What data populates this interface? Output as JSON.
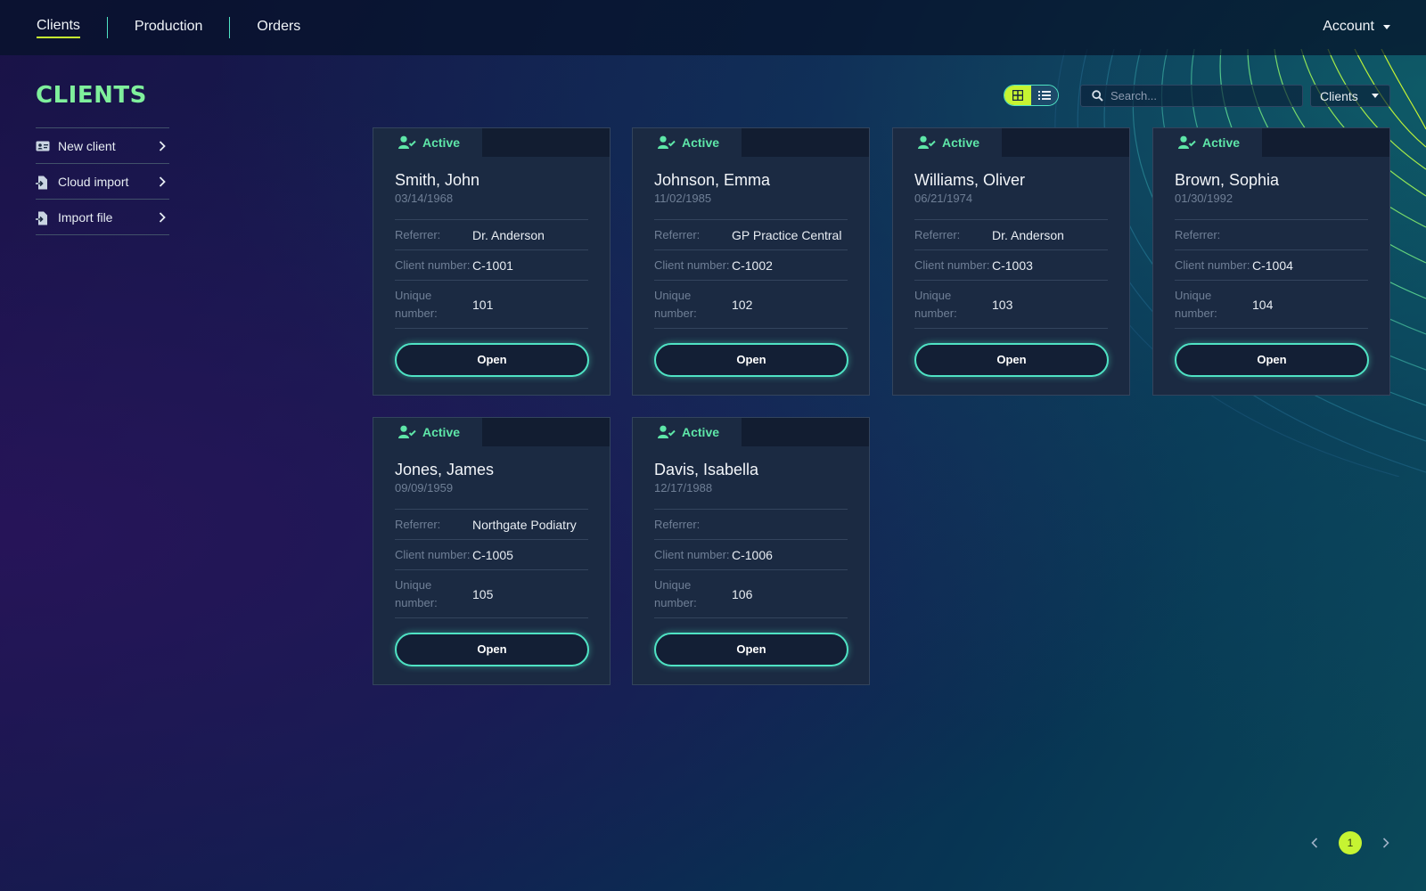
{
  "nav": {
    "items": [
      {
        "label": "Clients",
        "active": true
      },
      {
        "label": "Production",
        "active": false
      },
      {
        "label": "Orders",
        "active": false
      }
    ],
    "account_label": "Account"
  },
  "page": {
    "title": "CLIENTS"
  },
  "sidebar": {
    "items": [
      {
        "label": "New client",
        "icon": "id-card-icon"
      },
      {
        "label": "Cloud import",
        "icon": "file-import-icon"
      },
      {
        "label": "Import file",
        "icon": "file-import-icon"
      }
    ]
  },
  "toolbar": {
    "view_modes": [
      {
        "name": "grid-view",
        "icon": "grid-icon",
        "active": true
      },
      {
        "name": "list-view",
        "icon": "list-icon",
        "active": false
      }
    ],
    "search_placeholder": "Search...",
    "search_value": "",
    "scope_selected": "Clients"
  },
  "labels": {
    "referrer": "Referrer:",
    "client_number": "Client number:",
    "unique_number": "Unique number:",
    "open": "Open"
  },
  "clients": [
    {
      "status": "Active",
      "name": "Smith, John",
      "dob": "03/14/1968",
      "referrer": "Dr. Anderson",
      "client_number": "C-1001",
      "unique_number": "101"
    },
    {
      "status": "Active",
      "name": "Johnson, Emma",
      "dob": "11/02/1985",
      "referrer": "GP Practice Central",
      "client_number": "C-1002",
      "unique_number": "102"
    },
    {
      "status": "Active",
      "name": "Williams, Oliver",
      "dob": "06/21/1974",
      "referrer": "Dr. Anderson",
      "client_number": "C-1003",
      "unique_number": "103"
    },
    {
      "status": "Active",
      "name": "Brown, Sophia",
      "dob": "01/30/1992",
      "referrer": "",
      "client_number": "C-1004",
      "unique_number": "104"
    },
    {
      "status": "Active",
      "name": "Jones, James",
      "dob": "09/09/1959",
      "referrer": "Northgate Podiatry",
      "client_number": "C-1005",
      "unique_number": "105"
    },
    {
      "status": "Active",
      "name": "Davis, Isabella",
      "dob": "12/17/1988",
      "referrer": "",
      "client_number": "C-1006",
      "unique_number": "106"
    }
  ],
  "pagination": {
    "current_page": "1"
  },
  "colors": {
    "accent": "#c6f432",
    "teal": "#4fe3c4",
    "status_active": "#5ee6a8",
    "title": "#7ff09c",
    "card_bg": "#1b2a42"
  }
}
